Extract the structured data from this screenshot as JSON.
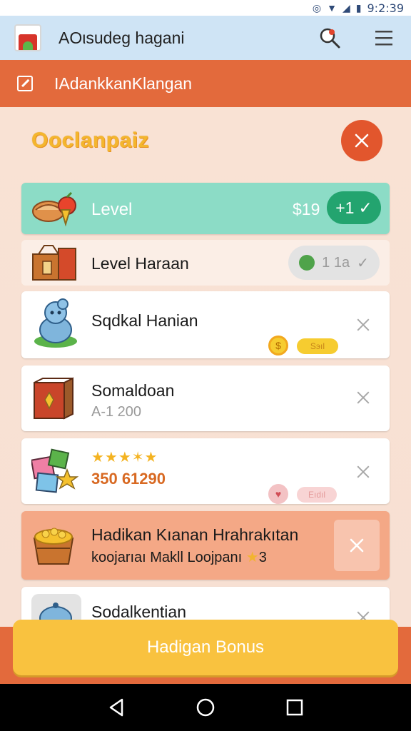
{
  "status_bar": {
    "time": "9:2:39"
  },
  "app_bar": {
    "title": "AOιsudeg hagani",
    "logo_icon": "app-logo",
    "search_icon": "search-icon",
    "menu_icon": "menu-icon"
  },
  "banner": {
    "title": "IAdankkanKlangan",
    "icon": "checkbox-icon"
  },
  "panel": {
    "title": "Ooclanpaiz"
  },
  "items": [
    {
      "title": "Level",
      "price": "$19",
      "pill": "+1"
    },
    {
      "title": "Level Haraan",
      "pill": "1 1a"
    },
    {
      "title": "Sqdkal Hanian",
      "tag": "Sэıl"
    },
    {
      "title": "Somaldoan",
      "subtitle": "A-1 200"
    },
    {
      "stars": "★★★✶★",
      "price": "350 61290",
      "tag": "Eıdıl"
    },
    {
      "title": "Hadikan Kıanan Hrahrakıtan",
      "subtitle": "koojarıaı Makll  Loojpanı",
      "star_value": "3"
    },
    {
      "title": "Sodalkentian"
    }
  ],
  "bonus_button": {
    "label": "Hadigan Bonus"
  },
  "colors": {
    "accent_orange": "#e36a3c",
    "teal": "#8cdcc6",
    "green_pill": "#23a46f",
    "bonus_yellow": "#f9c23f"
  }
}
